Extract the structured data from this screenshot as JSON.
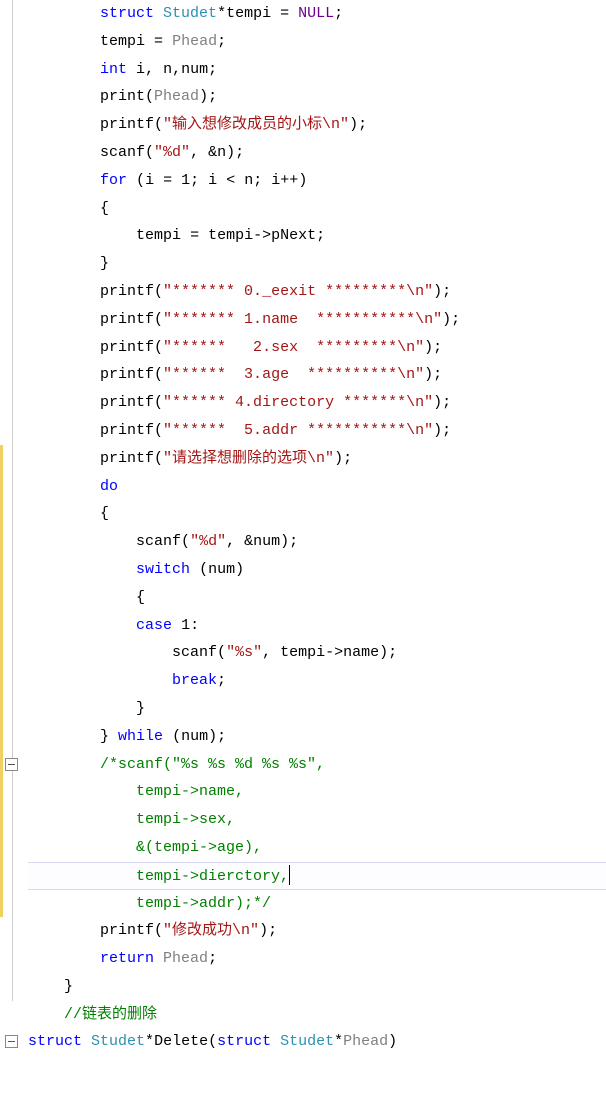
{
  "code": {
    "lines": [
      {
        "indent": 2,
        "tokens": [
          [
            "kw",
            "struct"
          ],
          [
            "",
            " "
          ],
          [
            "type",
            "Studet"
          ],
          [
            "punct",
            "*"
          ],
          [
            "ident",
            "tempi"
          ],
          [
            "",
            " "
          ],
          [
            "punct",
            "="
          ],
          [
            "",
            " "
          ],
          [
            "macro",
            "NULL"
          ],
          [
            "punct",
            ";"
          ]
        ]
      },
      {
        "indent": 2,
        "tokens": [
          [
            "ident",
            "tempi"
          ],
          [
            "",
            " "
          ],
          [
            "punct",
            "="
          ],
          [
            "",
            " "
          ],
          [
            "pre",
            "Phead"
          ],
          [
            "punct",
            ";"
          ]
        ]
      },
      {
        "indent": 2,
        "tokens": [
          [
            "kw",
            "int"
          ],
          [
            "",
            " "
          ],
          [
            "ident",
            "i"
          ],
          [
            "punct",
            ","
          ],
          [
            "",
            " "
          ],
          [
            "ident",
            "n"
          ],
          [
            "punct",
            ","
          ],
          [
            "ident",
            "num"
          ],
          [
            "punct",
            ";"
          ]
        ]
      },
      {
        "indent": 2,
        "tokens": [
          [
            "ident",
            "print"
          ],
          [
            "punct",
            "("
          ],
          [
            "pre",
            "Phead"
          ],
          [
            "punct",
            ")"
          ],
          [
            "punct",
            ";"
          ]
        ]
      },
      {
        "indent": 2,
        "tokens": [
          [
            "ident",
            "printf"
          ],
          [
            "punct",
            "("
          ],
          [
            "str",
            "\"输入想修改成员的小标\\n\""
          ],
          [
            "punct",
            ")"
          ],
          [
            "punct",
            ";"
          ]
        ]
      },
      {
        "indent": 2,
        "tokens": [
          [
            "ident",
            "scanf"
          ],
          [
            "punct",
            "("
          ],
          [
            "str",
            "\"%d\""
          ],
          [
            "punct",
            ","
          ],
          [
            "",
            " "
          ],
          [
            "punct",
            "&"
          ],
          [
            "ident",
            "n"
          ],
          [
            "punct",
            ")"
          ],
          [
            "punct",
            ";"
          ]
        ]
      },
      {
        "indent": 2,
        "tokens": [
          [
            "kw",
            "for"
          ],
          [
            "",
            " "
          ],
          [
            "punct",
            "("
          ],
          [
            "ident",
            "i"
          ],
          [
            "",
            " "
          ],
          [
            "punct",
            "="
          ],
          [
            "",
            " "
          ],
          [
            "num",
            "1"
          ],
          [
            "punct",
            ";"
          ],
          [
            "",
            " "
          ],
          [
            "ident",
            "i"
          ],
          [
            "",
            " "
          ],
          [
            "punct",
            "<"
          ],
          [
            "",
            " "
          ],
          [
            "ident",
            "n"
          ],
          [
            "punct",
            ";"
          ],
          [
            "",
            " "
          ],
          [
            "ident",
            "i"
          ],
          [
            "punct",
            "++"
          ],
          [
            "punct",
            ")"
          ]
        ]
      },
      {
        "indent": 2,
        "tokens": [
          [
            "punct",
            "{"
          ]
        ]
      },
      {
        "indent": 3,
        "tokens": [
          [
            "ident",
            "tempi"
          ],
          [
            "",
            " "
          ],
          [
            "punct",
            "="
          ],
          [
            "",
            " "
          ],
          [
            "ident",
            "tempi"
          ],
          [
            "punct",
            "->"
          ],
          [
            "ident",
            "pNext"
          ],
          [
            "punct",
            ";"
          ]
        ]
      },
      {
        "indent": 2,
        "tokens": [
          [
            "punct",
            "}"
          ]
        ]
      },
      {
        "indent": 2,
        "tokens": [
          [
            "ident",
            "printf"
          ],
          [
            "punct",
            "("
          ],
          [
            "str",
            "\"******* 0._eexit *********\\n\""
          ],
          [
            "punct",
            ")"
          ],
          [
            "punct",
            ";"
          ]
        ]
      },
      {
        "indent": 2,
        "tokens": [
          [
            "ident",
            "printf"
          ],
          [
            "punct",
            "("
          ],
          [
            "str",
            "\"******* 1.name  ***********\\n\""
          ],
          [
            "punct",
            ")"
          ],
          [
            "punct",
            ";"
          ]
        ]
      },
      {
        "indent": 2,
        "tokens": [
          [
            "ident",
            "printf"
          ],
          [
            "punct",
            "("
          ],
          [
            "str",
            "\"******   2.sex  *********\\n\""
          ],
          [
            "punct",
            ")"
          ],
          [
            "punct",
            ";"
          ]
        ]
      },
      {
        "indent": 2,
        "tokens": [
          [
            "ident",
            "printf"
          ],
          [
            "punct",
            "("
          ],
          [
            "str",
            "\"******  3.age  **********\\n\""
          ],
          [
            "punct",
            ")"
          ],
          [
            "punct",
            ";"
          ]
        ]
      },
      {
        "indent": 2,
        "tokens": [
          [
            "ident",
            "printf"
          ],
          [
            "punct",
            "("
          ],
          [
            "str",
            "\"****** 4.directory *******\\n\""
          ],
          [
            "punct",
            ")"
          ],
          [
            "punct",
            ";"
          ]
        ]
      },
      {
        "indent": 2,
        "tokens": [
          [
            "ident",
            "printf"
          ],
          [
            "punct",
            "("
          ],
          [
            "str",
            "\"******  5.addr ***********\\n\""
          ],
          [
            "punct",
            ")"
          ],
          [
            "punct",
            ";"
          ]
        ]
      },
      {
        "indent": 2,
        "tokens": [
          [
            "ident",
            "printf"
          ],
          [
            "punct",
            "("
          ],
          [
            "str",
            "\"请选择想删除的选项\\n\""
          ],
          [
            "punct",
            ")"
          ],
          [
            "punct",
            ";"
          ]
        ]
      },
      {
        "indent": 2,
        "tokens": [
          [
            "kw",
            "do"
          ]
        ]
      },
      {
        "indent": 2,
        "tokens": [
          [
            "punct",
            "{"
          ]
        ]
      },
      {
        "indent": 3,
        "tokens": [
          [
            "ident",
            "scanf"
          ],
          [
            "punct",
            "("
          ],
          [
            "str",
            "\"%d\""
          ],
          [
            "punct",
            ","
          ],
          [
            "",
            " "
          ],
          [
            "punct",
            "&"
          ],
          [
            "ident",
            "num"
          ],
          [
            "punct",
            ")"
          ],
          [
            "punct",
            ";"
          ]
        ]
      },
      {
        "indent": 3,
        "tokens": [
          [
            "kw",
            "switch"
          ],
          [
            "",
            " "
          ],
          [
            "punct",
            "("
          ],
          [
            "ident",
            "num"
          ],
          [
            "punct",
            ")"
          ]
        ]
      },
      {
        "indent": 3,
        "tokens": [
          [
            "punct",
            "{"
          ]
        ]
      },
      {
        "indent": 3,
        "tokens": [
          [
            "kw",
            "case"
          ],
          [
            "",
            " "
          ],
          [
            "num",
            "1"
          ],
          [
            "punct",
            ":"
          ]
        ]
      },
      {
        "indent": 4,
        "tokens": [
          [
            "ident",
            "scanf"
          ],
          [
            "punct",
            "("
          ],
          [
            "str",
            "\"%s\""
          ],
          [
            "punct",
            ","
          ],
          [
            "",
            " "
          ],
          [
            "ident",
            "tempi"
          ],
          [
            "punct",
            "->"
          ],
          [
            "ident",
            "name"
          ],
          [
            "punct",
            ")"
          ],
          [
            "punct",
            ";"
          ]
        ]
      },
      {
        "indent": 4,
        "tokens": [
          [
            "kw",
            "break"
          ],
          [
            "punct",
            ";"
          ]
        ]
      },
      {
        "indent": 3,
        "tokens": [
          [
            "punct",
            "}"
          ]
        ]
      },
      {
        "indent": 2,
        "tokens": [
          [
            "punct",
            "}"
          ],
          [
            "",
            " "
          ],
          [
            "kw",
            "while"
          ],
          [
            "",
            " "
          ],
          [
            "punct",
            "("
          ],
          [
            "ident",
            "num"
          ],
          [
            "punct",
            ")"
          ],
          [
            "punct",
            ";"
          ]
        ]
      },
      {
        "indent": 2,
        "tokens": [
          [
            "cmt",
            "/*scanf(\"%s %s %d %s %s\","
          ]
        ]
      },
      {
        "indent": 3,
        "tokens": [
          [
            "cmt",
            "tempi->name,"
          ]
        ]
      },
      {
        "indent": 3,
        "tokens": [
          [
            "cmt",
            "tempi->sex,"
          ]
        ]
      },
      {
        "indent": 3,
        "tokens": [
          [
            "cmt",
            "&(tempi->age),"
          ]
        ]
      },
      {
        "indent": 3,
        "cursor": true,
        "tokens": [
          [
            "cmt",
            "tempi->dierctory,"
          ]
        ]
      },
      {
        "indent": 3,
        "tokens": [
          [
            "cmt",
            "tempi->addr);*/"
          ]
        ]
      },
      {
        "indent": 2,
        "tokens": [
          [
            "ident",
            "printf"
          ],
          [
            "punct",
            "("
          ],
          [
            "str",
            "\"修改成功\\n\""
          ],
          [
            "punct",
            ")"
          ],
          [
            "punct",
            ";"
          ]
        ]
      },
      {
        "indent": 2,
        "tokens": [
          [
            "kw",
            "return"
          ],
          [
            "",
            " "
          ],
          [
            "pre",
            "Phead"
          ],
          [
            "punct",
            ";"
          ]
        ]
      },
      {
        "indent": 1,
        "tokens": [
          [
            "punct",
            "}"
          ]
        ]
      },
      {
        "indent": 1,
        "tokens": [
          [
            "cmt",
            "//链表的删除"
          ]
        ]
      },
      {
        "indent": 0,
        "tokens": [
          [
            "kw",
            "struct"
          ],
          [
            "",
            " "
          ],
          [
            "type",
            "Studet"
          ],
          [
            "punct",
            "*"
          ],
          [
            "ident",
            "Delete"
          ],
          [
            "punct",
            "("
          ],
          [
            "kw",
            "struct"
          ],
          [
            "",
            " "
          ],
          [
            "type",
            "Studet"
          ],
          [
            "punct",
            "*"
          ],
          [
            "pre",
            "Phead"
          ],
          [
            "punct",
            ")"
          ]
        ]
      }
    ]
  },
  "gutter": {
    "foldBoxes": [
      27,
      37
    ],
    "changeBars": [
      {
        "start": 16,
        "end": 32
      }
    ],
    "bracketLine": {
      "start": 0,
      "end": 35
    }
  }
}
